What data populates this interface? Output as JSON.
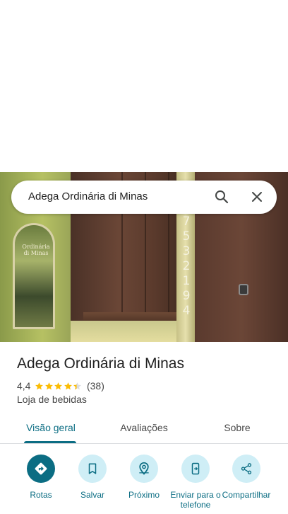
{
  "search": {
    "query": "Adega Ordinária di Minas",
    "search_icon": "search-icon",
    "close_icon": "close-icon"
  },
  "photo": {
    "poster_text": "Ordinária di Minas",
    "house_number": "7532194"
  },
  "place": {
    "title": "Adega Ordinária di Minas",
    "rating": "4,4",
    "rating_value": 4.4,
    "rating_max": 5,
    "reviews": "(38)",
    "category": "Loja de bebidas"
  },
  "tabs": [
    {
      "label": "Visão geral",
      "active": true
    },
    {
      "label": "Avaliações",
      "active": false
    },
    {
      "label": "Sobre",
      "active": false
    }
  ],
  "actions": [
    {
      "label": "Rotas",
      "icon": "directions-icon"
    },
    {
      "label": "Salvar",
      "icon": "bookmark-icon"
    },
    {
      "label": "Próximo",
      "icon": "nearby-icon"
    },
    {
      "label": "Enviar para o telefone",
      "icon": "send-to-phone-icon"
    },
    {
      "label": "Compartilhar",
      "icon": "share-icon"
    }
  ],
  "colors": {
    "accent": "#0b6d83",
    "action_bg": "#cfeef6",
    "star": "#fbbc04"
  }
}
